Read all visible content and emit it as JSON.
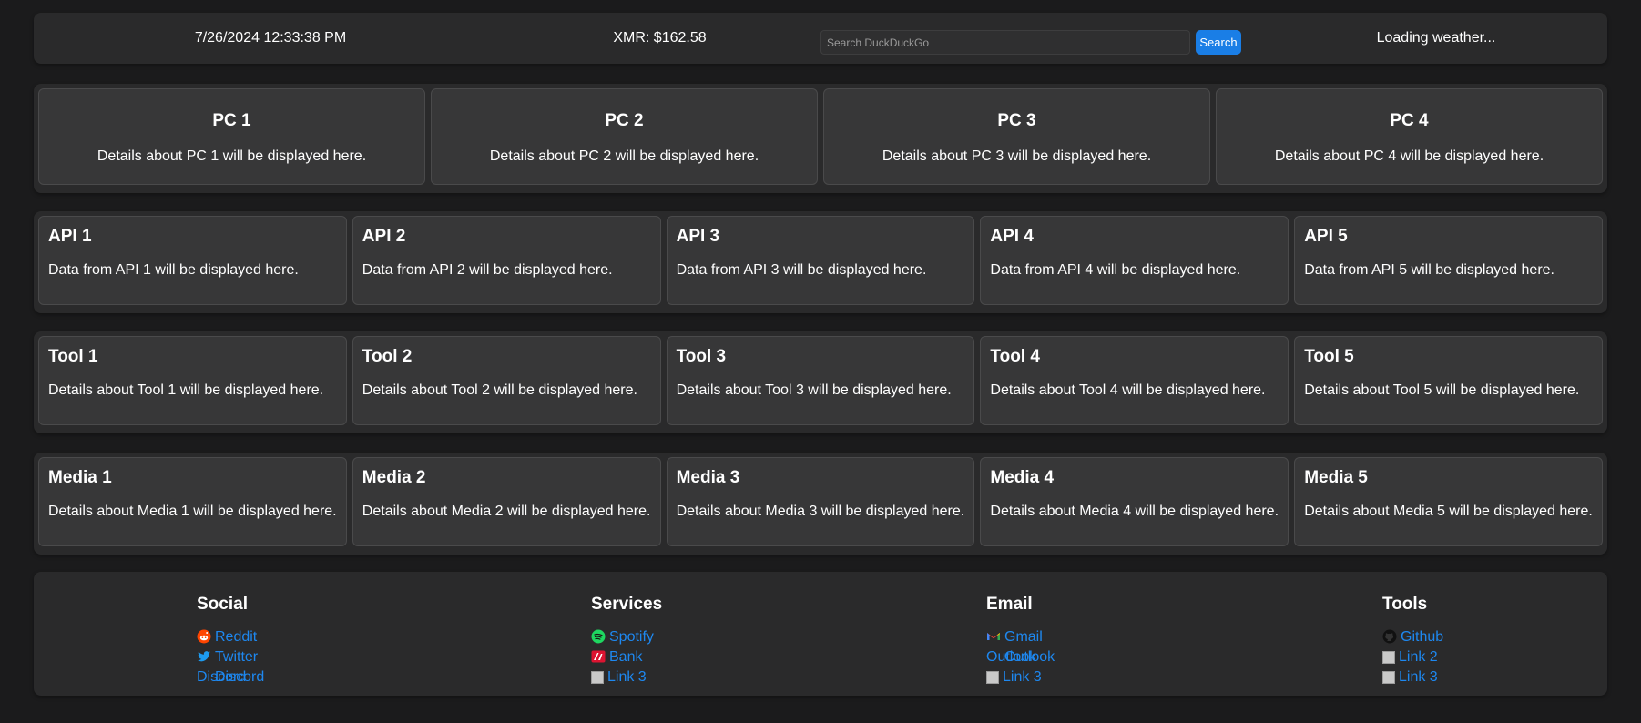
{
  "topbar": {
    "datetime": "7/26/2024 12:33:38 PM",
    "xmr_price": "XMR: $162.58",
    "search_placeholder": "Search DuckDuckGo",
    "search_button": "Search",
    "weather": "Loading weather..."
  },
  "pcs": [
    {
      "title": "PC 1",
      "text": "Details about PC 1 will be displayed here."
    },
    {
      "title": "PC 2",
      "text": "Details about PC 2 will be displayed here."
    },
    {
      "title": "PC 3",
      "text": "Details about PC 3 will be displayed here."
    },
    {
      "title": "PC 4",
      "text": "Details about PC 4 will be displayed here."
    }
  ],
  "apis": [
    {
      "title": "API 1",
      "text": "Data from API 1 will be displayed here."
    },
    {
      "title": "API 2",
      "text": "Data from API 2 will be displayed here."
    },
    {
      "title": "API 3",
      "text": "Data from API 3 will be displayed here."
    },
    {
      "title": "API 4",
      "text": "Data from API 4 will be displayed here."
    },
    {
      "title": "API 5",
      "text": "Data from API 5 will be displayed here."
    }
  ],
  "tools": [
    {
      "title": "Tool 1",
      "text": "Details about Tool 1 will be displayed here."
    },
    {
      "title": "Tool 2",
      "text": "Details about Tool 2 will be displayed here."
    },
    {
      "title": "Tool 3",
      "text": "Details about Tool 3 will be displayed here."
    },
    {
      "title": "Tool 4",
      "text": "Details about Tool 4 will be displayed here."
    },
    {
      "title": "Tool 5",
      "text": "Details about Tool 5 will be displayed here."
    }
  ],
  "media": [
    {
      "title": "Media 1",
      "text": "Details about Media 1 will be displayed here."
    },
    {
      "title": "Media 2",
      "text": "Details about Media 2 will be displayed here."
    },
    {
      "title": "Media 3",
      "text": "Details about Media 3 will be displayed here."
    },
    {
      "title": "Media 4",
      "text": "Details about Media 4 will be displayed here."
    },
    {
      "title": "Media 5",
      "text": "Details about Media 5 will be displayed here."
    }
  ],
  "footer": {
    "social": {
      "heading": "Social",
      "links": [
        {
          "label": "Reddit",
          "icon": "reddit-icon"
        },
        {
          "label": "Twitter",
          "icon": "twitter-icon"
        },
        {
          "label": "Discord",
          "alt": "Discord",
          "icon": "broken-image-icon"
        }
      ]
    },
    "services": {
      "heading": "Services",
      "links": [
        {
          "label": "Spotify",
          "icon": "spotify-icon"
        },
        {
          "label": "Bank",
          "icon": "bank-icon"
        },
        {
          "label": "Link 3",
          "icon": "broken-image-icon"
        }
      ]
    },
    "email": {
      "heading": "Email",
      "links": [
        {
          "label": "Gmail",
          "icon": "gmail-icon"
        },
        {
          "label": "Outlook",
          "alt": "Outlook",
          "icon": "broken-image-icon"
        },
        {
          "label": "Link 3",
          "icon": "broken-image-icon"
        }
      ]
    },
    "tools": {
      "heading": "Tools",
      "links": [
        {
          "label": "Github",
          "icon": "github-icon"
        },
        {
          "label": "Link 2",
          "icon": "broken-image-icon"
        },
        {
          "label": "Link 3",
          "icon": "broken-image-icon"
        }
      ]
    }
  },
  "colors": {
    "page_bg": "#1b1b1c",
    "panel_bg": "#2a2a2b",
    "card_bg": "#373738",
    "link": "#1e88f0",
    "button": "#1a7ee6"
  }
}
